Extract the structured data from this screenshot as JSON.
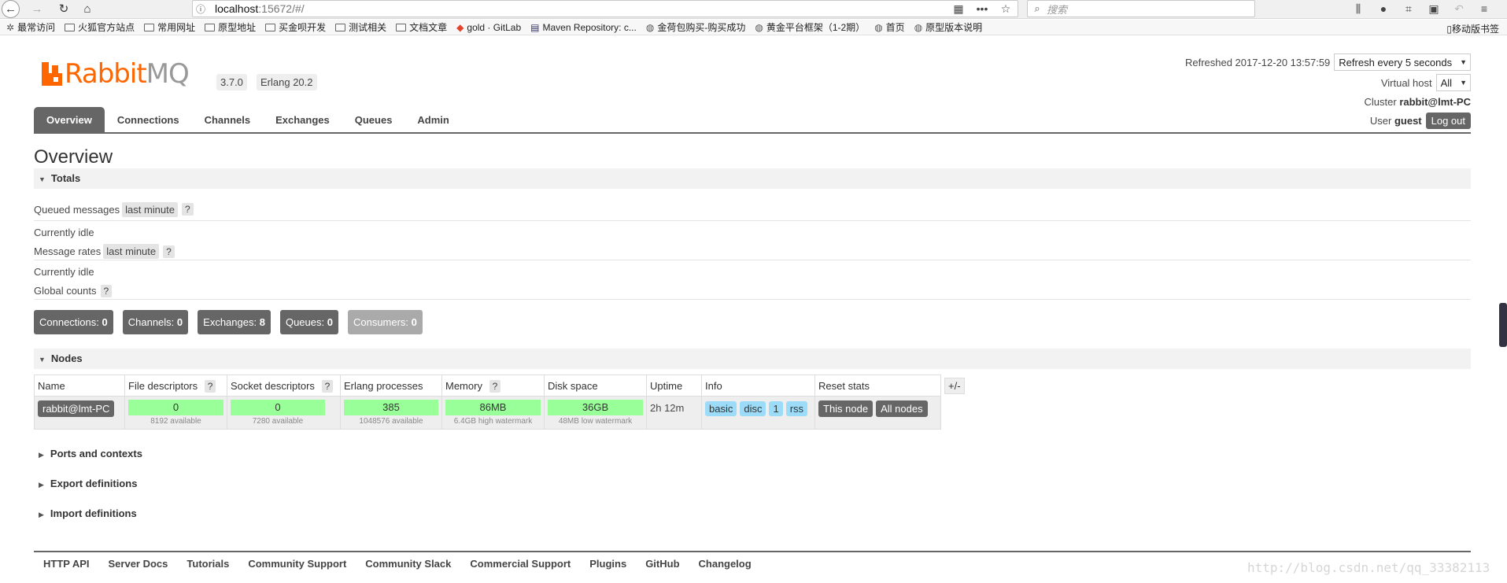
{
  "browser": {
    "url_host": "localhost",
    "url_rest": ":15672/#/",
    "search_placeholder": "搜索",
    "bookmarks": [
      "最常访问",
      "火狐官方站点",
      "常用网址",
      "原型地址",
      "买金呗开发",
      "测试相关",
      "文档文章",
      "gold · GitLab",
      "Maven Repository: c...",
      "金荷包购买-购买成功",
      "黄金平台框架（1-2期）",
      "首页",
      "原型版本说明"
    ],
    "mobile_bookmarks": "移动版书签"
  },
  "header": {
    "logo_r": "Rabbit",
    "logo_mq": "MQ",
    "version": "3.7.0",
    "erlang": "Erlang 20.2",
    "refreshed_label": "Refreshed 2017-12-20 13:57:59",
    "refresh_select": "Refresh every 5 seconds",
    "vhost_label": "Virtual host",
    "vhost_value": "All",
    "cluster_label": "Cluster",
    "cluster_value": "rabbit@lmt-PC",
    "user_label": "User",
    "user_value": "guest",
    "logout": "Log out"
  },
  "tabs": [
    "Overview",
    "Connections",
    "Channels",
    "Exchanges",
    "Queues",
    "Admin"
  ],
  "overview": {
    "title": "Overview",
    "totals_title": "Totals",
    "queued_label": "Queued messages",
    "queued_range": "last minute",
    "idle1": "Currently idle",
    "rates_label": "Message rates",
    "rates_range": "last minute",
    "idle2": "Currently idle",
    "global_label": "Global counts",
    "help": "?",
    "counts": [
      {
        "label": "Connections:",
        "value": "0"
      },
      {
        "label": "Channels:",
        "value": "0"
      },
      {
        "label": "Exchanges:",
        "value": "8"
      },
      {
        "label": "Queues:",
        "value": "0"
      },
      {
        "label": "Consumers:",
        "value": "0"
      }
    ]
  },
  "nodes": {
    "title": "Nodes",
    "headers": [
      "Name",
      "File descriptors",
      "Socket descriptors",
      "Erlang processes",
      "Memory",
      "Disk space",
      "Uptime",
      "Info",
      "Reset stats"
    ],
    "plusminus": "+/-",
    "row": {
      "name": "rabbit@lmt-PC",
      "fd": "0",
      "fd_sub": "8192 available",
      "sd": "0",
      "sd_sub": "7280 available",
      "ep": "385",
      "ep_sub": "1048576 available",
      "mem": "86MB",
      "mem_sub": "6.4GB high watermark",
      "disk": "36GB",
      "disk_sub": "48MB low watermark",
      "uptime": "2h 12m",
      "info": [
        "basic",
        "disc",
        "1",
        "rss"
      ],
      "reset": [
        "This node",
        "All nodes"
      ]
    }
  },
  "sections": [
    "Ports and contexts",
    "Export definitions",
    "Import definitions"
  ],
  "footer": [
    "HTTP API",
    "Server Docs",
    "Tutorials",
    "Community Support",
    "Community Slack",
    "Commercial Support",
    "Plugins",
    "GitHub",
    "Changelog"
  ],
  "watermark": "http://blog.csdn.net/qq_33382113",
  "colors": {
    "brand": "#ff6600",
    "tab_active": "#666666",
    "bar_green": "#99ff99",
    "tag_blue": "#9cdcf8"
  }
}
